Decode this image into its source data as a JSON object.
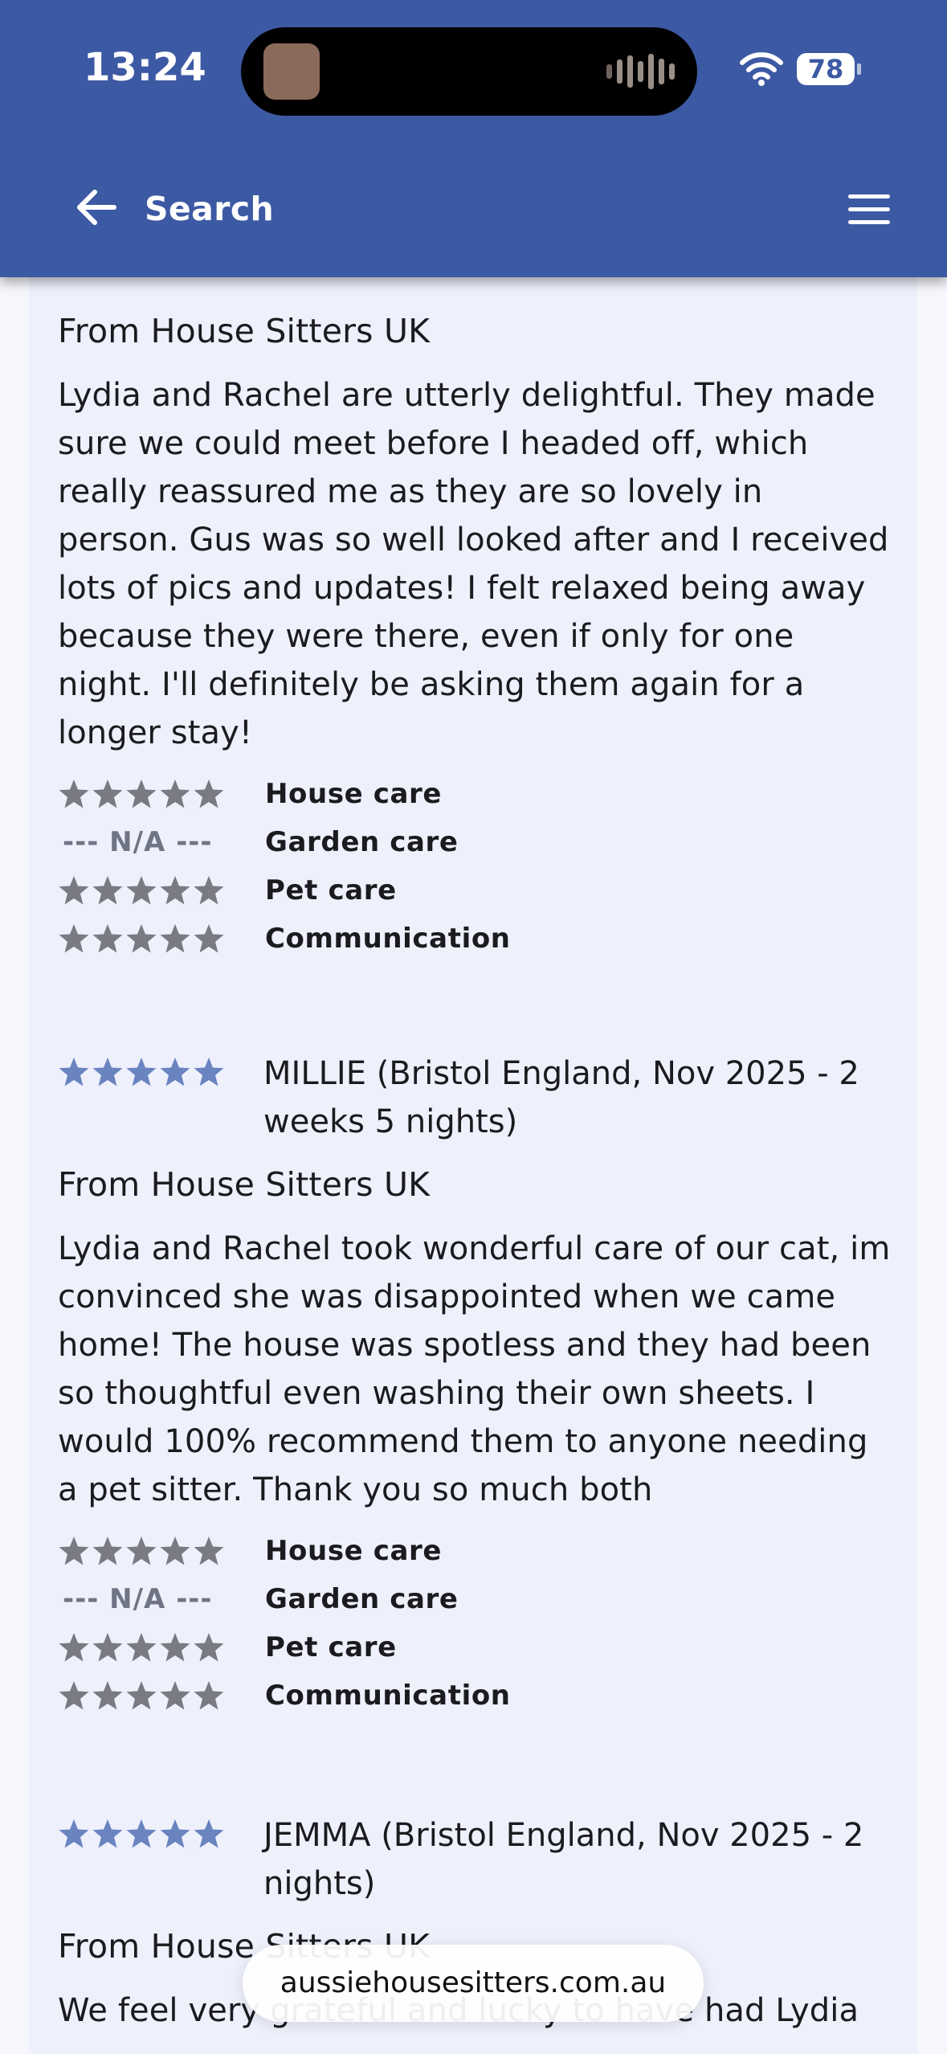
{
  "status_bar": {
    "time": "13:24",
    "battery": "78"
  },
  "nav": {
    "search_label": "Search"
  },
  "reviews": [
    {
      "source": "From House Sitters UK",
      "text": "Lydia and Rachel are utterly delightful. They made sure we could meet before I headed off, which really reassured me as they are so lovely in person. Gus was so well looked after and I received lots of pics and updates! I felt relaxed being away because they were there, even if only for one night. I'll definitely be asking them again for a longer stay!",
      "ratings": [
        {
          "label": "House care",
          "stars": 5
        },
        {
          "label": "Garden care",
          "na": "--- N/A ---"
        },
        {
          "label": "Pet care",
          "stars": 5
        },
        {
          "label": "Communication",
          "stars": 5
        }
      ]
    },
    {
      "reviewer": "MILLIE (Bristol England, Nov 2025 - 2 weeks 5 nights)",
      "overall_stars": 5,
      "source": "From House Sitters UK",
      "text": "Lydia and Rachel took wonderful care of our cat, im convinced she was disappointed when we came home! The house was spotless and they had been so thoughtful even washing their own sheets. I would 100% recommend them to anyone needing a pet sitter. Thank you so much both",
      "ratings": [
        {
          "label": "House care",
          "stars": 5
        },
        {
          "label": "Garden care",
          "na": "--- N/A ---"
        },
        {
          "label": "Pet care",
          "stars": 5
        },
        {
          "label": "Communication",
          "stars": 5
        }
      ]
    },
    {
      "reviewer": "JEMMA (Bristol England, Nov 2025 - 2 nights)",
      "overall_stars": 5,
      "source": "From House Sitters UK",
      "text": "We feel very grateful and lucky to have had Lydia"
    }
  ],
  "browser": {
    "url": "aussiehousesitters.com.au"
  },
  "colors": {
    "header": "#3c59a3",
    "star_grey": "#7a7a82",
    "star_blue": "#6a84c0"
  }
}
